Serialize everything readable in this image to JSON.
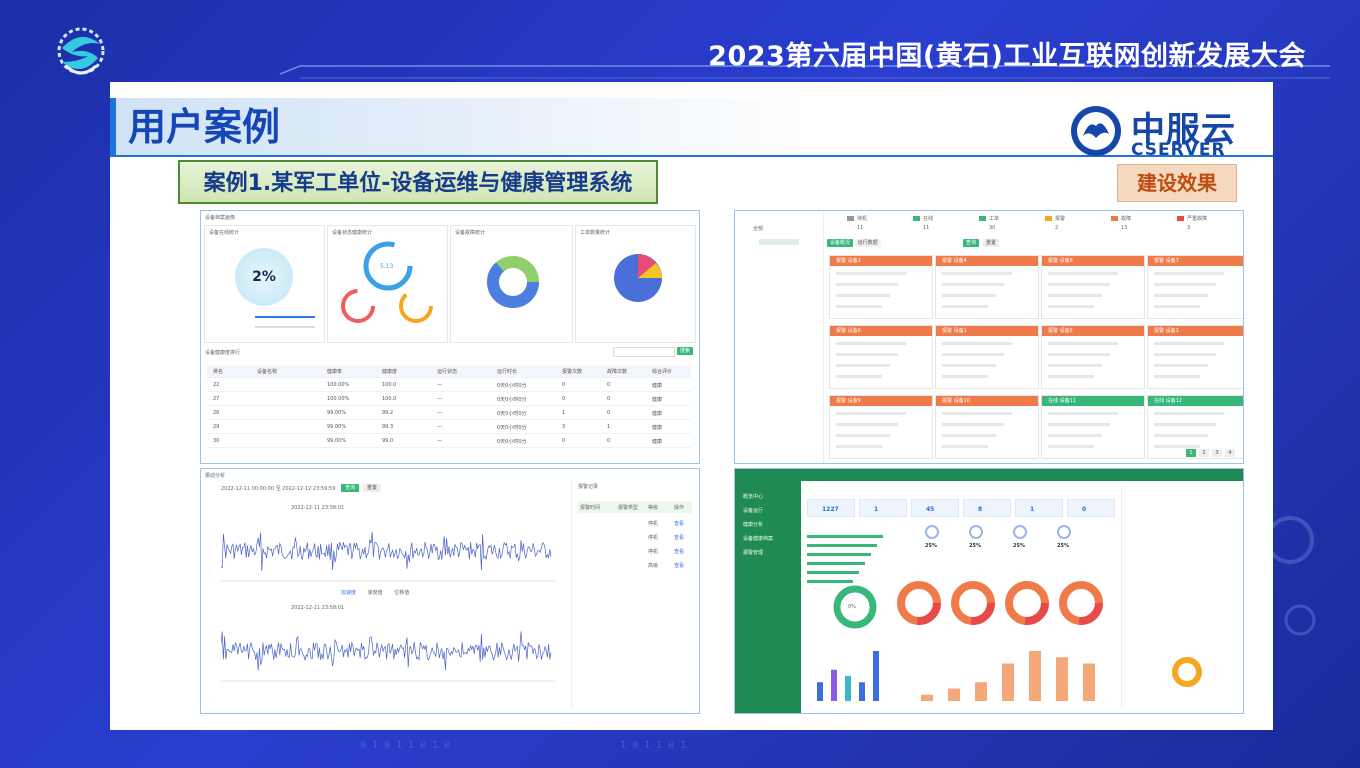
{
  "conference_title": "2023第六届中国(黄石)工业互联网创新发展大会",
  "section_title": "用户案例",
  "brand": {
    "name_cn": "中服云",
    "name_en": "CSERVER"
  },
  "case_title": "案例1.某军工单位-设备运维与健康管理系统",
  "effect_label": "建设效果",
  "panel1": {
    "header": "设备档案画像",
    "widgets": [
      "设备在线统计",
      "设备状态健康统计",
      "设备故障统计",
      "工单数量统计"
    ],
    "gauge_value": "2%",
    "ring_value": "5.13",
    "table_title": "设备健康度排行",
    "search_btn": "搜索",
    "columns": [
      "排名",
      "设备名称",
      "健康率",
      "健康度",
      "运行状态",
      "运行时长",
      "报警次数",
      "故障次数",
      "综合评价"
    ],
    "rows": [
      [
        "22",
        "",
        "100.00%",
        "100.0",
        "—",
        "0天0小时0分",
        "0",
        "0",
        "健康"
      ],
      [
        "27",
        "",
        "100.00%",
        "100.0",
        "—",
        "0天0小时0分",
        "0",
        "0",
        "健康"
      ],
      [
        "28",
        "",
        "99.00%",
        "99.2",
        "—",
        "0天0小时0分",
        "1",
        "0",
        "健康"
      ],
      [
        "29",
        "",
        "99.00%",
        "99.3",
        "—",
        "0天0小时0分",
        "3",
        "1",
        "健康"
      ],
      [
        "30",
        "",
        "99.00%",
        "99.0",
        "—",
        "0天0小时0分",
        "0",
        "0",
        "健康"
      ]
    ]
  },
  "panel2": {
    "header": "振动分析",
    "date_range": "2022-12-11 00:00:00  至  2022-12-12 23:59:59",
    "query_btn": "查询",
    "reset_btn": "重置",
    "chart1_title": "2022-12-11 23:58:01",
    "chart2_title": "2022-12-11 23:58:01",
    "legend": [
      "加速度",
      "速度值",
      "位移值"
    ],
    "side_title": "报警记录",
    "side_columns": [
      "报警时间",
      "报警类型",
      "等级",
      "操作"
    ],
    "side_rows": [
      [
        "",
        "",
        "停机",
        "查看"
      ],
      [
        "",
        "",
        "停机",
        "查看"
      ],
      [
        "",
        "",
        "停机",
        "查看"
      ],
      [
        "",
        "",
        "高级",
        "查看"
      ]
    ]
  },
  "panel3": {
    "status_labels": [
      "待机",
      "在线",
      "工单",
      "报警",
      "故障",
      "严重故障"
    ],
    "status_values": [
      "11",
      "11",
      "30",
      "2",
      "13",
      "3"
    ],
    "tree_root": "全部",
    "tabs": [
      "设备概况",
      "运行数据"
    ],
    "query_btn": "查询",
    "reset_btn": "重置",
    "card_labels": [
      "报警 设备2",
      "报警 设备4",
      "报警 设备6",
      "报警 设备7",
      "报警 设备8",
      "报警 设备1",
      "报警 设备5",
      "报警 设备3",
      "报警 设备9",
      "报警 设备10",
      "在线 设备11",
      "在线 设备12"
    ],
    "pagination": [
      "1",
      "2",
      "3",
      "4"
    ]
  },
  "panel4": {
    "menu": [
      "概览中心",
      "设备运行",
      "健康分析",
      "设备健康档案",
      "报警管理"
    ],
    "kpis": [
      "1227",
      "1",
      "45",
      "8",
      "1",
      "0"
    ],
    "percents": [
      "25%",
      "25%",
      "25%",
      "25%"
    ],
    "bar_values": [
      3,
      5,
      4,
      3,
      8
    ],
    "orange_bars": [
      1,
      2,
      3,
      6,
      8,
      7,
      6
    ],
    "donut_label": "0%"
  },
  "colors": {
    "accent": "#1e73d8",
    "bg": "#2a3ed0",
    "orange": "#f07b4a",
    "green": "#37b779"
  }
}
